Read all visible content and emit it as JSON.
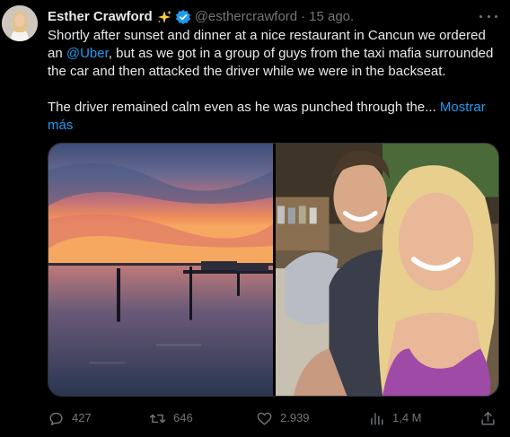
{
  "author": {
    "display_name": "Esther Crawford",
    "handle": "@esthercrawford",
    "date": "15 ago.",
    "verified": true,
    "avatar_icon": "avatar-woman"
  },
  "tweet": {
    "paragraph1_part1": "Shortly after sunset and dinner at a nice restaurant in Cancun we ordered an ",
    "mention": "@Uber",
    "paragraph1_part2": ", but as we got in a group of guys from the taxi mafia surrounded the car and then attacked the driver while we were in the backseat.",
    "paragraph2": "The driver remained calm even as he was punched through the... ",
    "show_more": "Mostrar más"
  },
  "actions": {
    "replies": "427",
    "reposts": "646",
    "likes": "2.939",
    "views": "1,4 M"
  },
  "colors": {
    "link": "#1d9bf0",
    "muted": "#71767b",
    "text": "#e7e9ea",
    "background": "#000000"
  }
}
